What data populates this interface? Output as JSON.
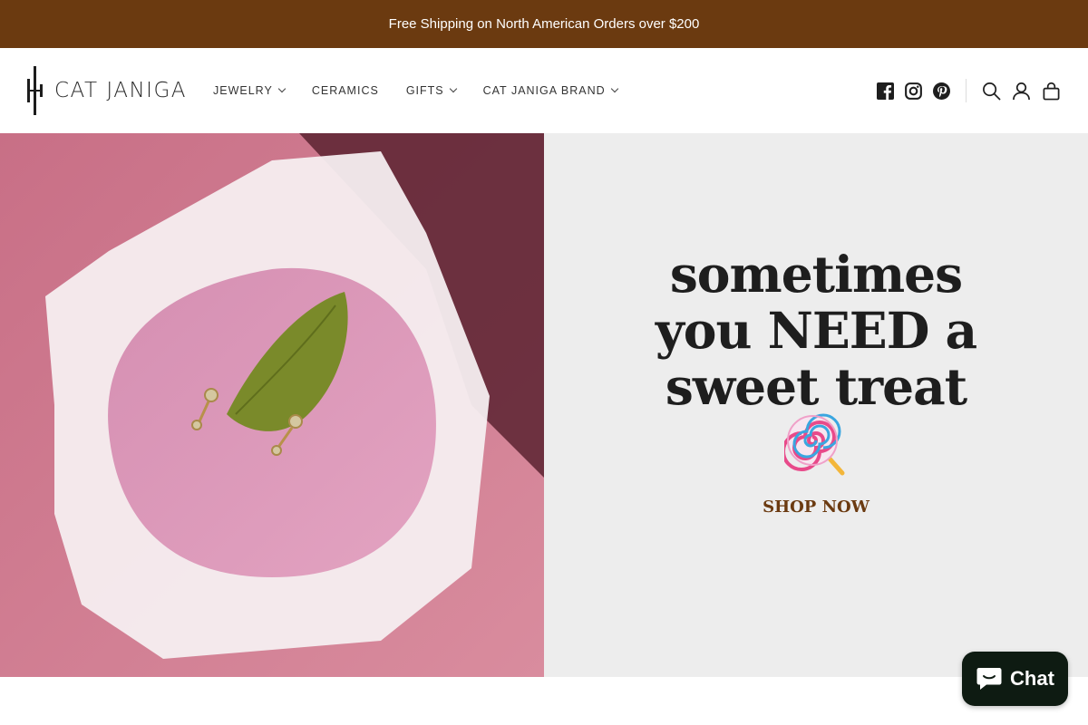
{
  "announcement": {
    "text": "Free Shipping on North American Orders over $200"
  },
  "brand": {
    "name": "CAT JANIGA"
  },
  "nav": {
    "items": [
      {
        "label": "JEWELRY",
        "has_dropdown": true
      },
      {
        "label": "CERAMICS",
        "has_dropdown": false
      },
      {
        "label": "GIFTS",
        "has_dropdown": true
      },
      {
        "label": "CAT JANIGA BRAND",
        "has_dropdown": true
      }
    ]
  },
  "header_icons": {
    "social": [
      "facebook-icon",
      "instagram-icon",
      "pinterest-icon"
    ],
    "tools": [
      "search-icon",
      "account-icon",
      "cart-icon"
    ]
  },
  "hero": {
    "headline_lines": [
      "sometimes",
      "you NEED a",
      "sweet treat"
    ],
    "emoji": "lollipop",
    "cta_label": "SHOP NOW",
    "panel_color": "#ededed"
  },
  "chat": {
    "label": "Chat"
  },
  "colors": {
    "announcement_bg": "#6b3a10",
    "accent": "#6b3a10",
    "chat_bg": "#0e1b12"
  }
}
